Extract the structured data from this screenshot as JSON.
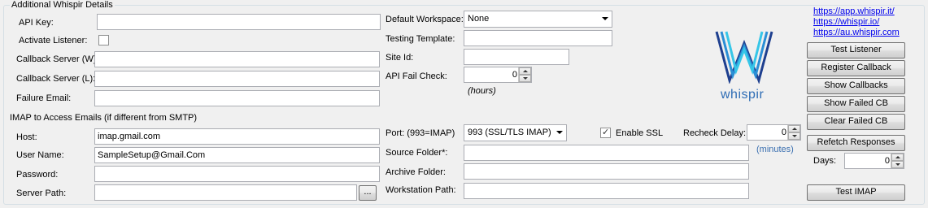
{
  "group": {
    "title": "Additional Whispir Details"
  },
  "left": {
    "api_key_label": "API Key:",
    "api_key_value": "",
    "activate_listener_label": "Activate Listener:",
    "activate_listener_checked": false,
    "callback_w_label": "Callback Server (W)",
    "callback_w_value": "",
    "callback_l_label": "Callback Server (L):",
    "callback_l_value": "",
    "failure_email_label": "Failure Email:",
    "failure_email_value": ""
  },
  "middle": {
    "default_workspace_label": "Default Workspace:",
    "default_workspace_value": "None",
    "testing_template_label": "Testing Template:",
    "testing_template_value": "",
    "site_id_label": "Site Id:",
    "site_id_value": "",
    "api_fail_check_label": "API Fail Check:",
    "api_fail_check_value": "0",
    "hours_hint": "(hours)"
  },
  "logo": {
    "text": "whispir",
    "colors": [
      "#1e3f8f",
      "#2a8fd6",
      "#36c6e8"
    ]
  },
  "links": [
    "https://app.whispir.it/",
    "https://whispir.io/",
    "https://au.whispir.com"
  ],
  "buttons": {
    "test_listener": "Test Listener",
    "register_callback": "Register Callback",
    "show_callbacks": "Show Callbacks",
    "show_failed_cb": "Show Failed CB",
    "clear_failed_cb": "Clear Failed CB",
    "refetch_responses": "Refetch Responses",
    "test_imap": "Test IMAP",
    "browse": "..."
  },
  "imap": {
    "section_title": "IMAP to Access Emails (if different from SMTP)",
    "host_label": "Host:",
    "host_value": "imap.gmail.com",
    "user_label": "User Name:",
    "user_value": "SampleSetup@Gmail.Com",
    "password_label": "Password:",
    "password_value": "",
    "server_path_label": "Server Path:",
    "server_path_value": "",
    "port_label": "Port:  (993=IMAP)",
    "port_value": "993 (SSL/TLS IMAP)",
    "enable_ssl_label": "Enable SSL",
    "enable_ssl_checked": true,
    "recheck_delay_label": "Recheck Delay:",
    "recheck_delay_value": "0",
    "minutes_hint": "(minutes)",
    "source_folder_label": "Source Folder*:",
    "source_folder_value": "",
    "archive_folder_label": "Archive Folder:",
    "archive_folder_value": "",
    "workstation_path_label": "Workstation Path:",
    "workstation_path_value": "",
    "days_label": "Days:",
    "days_value": "0"
  }
}
